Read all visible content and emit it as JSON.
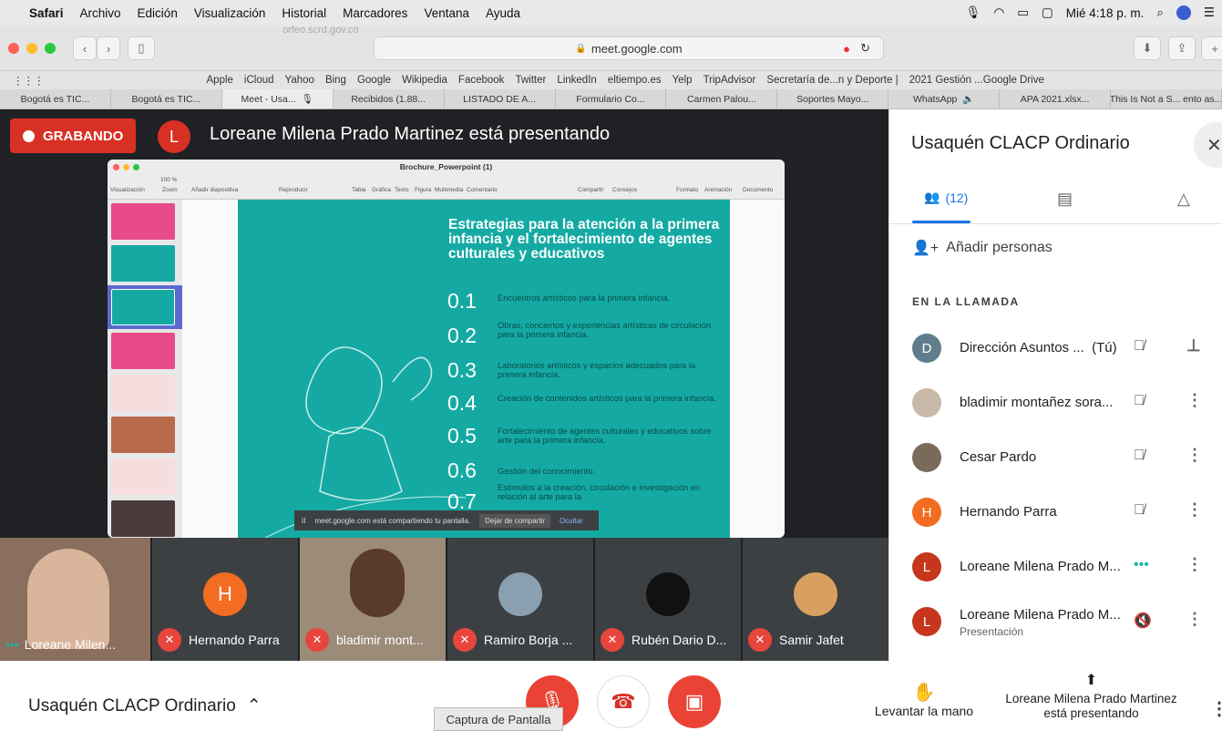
{
  "menubar": {
    "app": "Safari",
    "items": [
      "Archivo",
      "Edición",
      "Visualización",
      "Historial",
      "Marcadores",
      "Ventana",
      "Ayuda"
    ],
    "clock": "Mié 4:18 p. m."
  },
  "browser": {
    "url": "meet.google.com",
    "ghost_title": "orfeo.scrd.gov.co",
    "bookmarks": [
      "Apple",
      "iCloud",
      "Yahoo",
      "Bing",
      "Google",
      "Wikipedia",
      "Facebook",
      "Twitter",
      "LinkedIn",
      "eltiempo.es",
      "Yelp",
      "TripAdvisor",
      "Secretaría de...n y Deporte |",
      "2021 Gestión ...Google Drive"
    ],
    "tabs": [
      "Bogotá es TIC...",
      "Bogotá es TIC...",
      "Meet - Usa...",
      "Recibidos (1.88...",
      "LISTADO DE A...",
      "Formulario Co...",
      "Carmen Palou...",
      "Soportes Mayo...",
      "WhatsApp",
      "APA 2021.xlsx...",
      "This Is Not a S... ento as..."
    ]
  },
  "stage": {
    "recording_label": "GRABANDO",
    "presenter_initial": "L",
    "presenting_text": "Loreane Milena Prado Martinez está presentando"
  },
  "keynote": {
    "title": "Brochure_Powerpoint (1)",
    "toolbar": [
      "Visualización",
      "Zoom",
      "Añadir diapositiva",
      "Reproducir",
      "Tabla",
      "Gráfica",
      "Texto",
      "Figura",
      "Multimedia",
      "Comentario",
      "Compartir",
      "Consejos",
      "Formato",
      "Animación",
      "Documento"
    ],
    "zoom": "100 %",
    "slide_title": "Estrategias para la atención a la primera infancia y el fortalecimiento de agentes culturales y educativos",
    "items": [
      {
        "num": "0.1",
        "text": "Encuentros artísticos para la primera infancia."
      },
      {
        "num": "0.2",
        "text": "Obras, conciertos y experiencias artísticas de circulación para la primera infancia."
      },
      {
        "num": "0.3",
        "text": "Laboratorios artísticos y espacios adecuados para la primera infancia."
      },
      {
        "num": "0.4",
        "text": "Creación de contenidos artísticos para la primera infancia."
      },
      {
        "num": "0.5",
        "text": "Fortalecimiento de agentes culturales y educativos sobre arte para la primera infancia."
      },
      {
        "num": "0.6",
        "text": "Gestión del conocimiento."
      },
      {
        "num": "0.7",
        "text": "Estímulos a la creación, circulación e investigación en relación al arte para la"
      }
    ]
  },
  "share_bar": {
    "text": "meet.google.com está compartiendo tu pantalla.",
    "stop": "Dejar de compartir",
    "hide": "Ocultar"
  },
  "tiles": [
    {
      "name": "Loreane Milen...",
      "initial": "",
      "muted": false
    },
    {
      "name": "Hernando Parra",
      "initial": "H",
      "muted": true
    },
    {
      "name": "bladimir mont...",
      "initial": "",
      "muted": true
    },
    {
      "name": "Ramiro Borja ...",
      "initial": "",
      "muted": true
    },
    {
      "name": "Rubén Dario D...",
      "initial": "",
      "muted": true
    },
    {
      "name": "Samir Jafet",
      "initial": "",
      "muted": true
    }
  ],
  "sidebar": {
    "title": "Usaquén CLACP Ordinario",
    "people_count": "(12)",
    "add_people": "Añadir personas",
    "section": "EN LA LLAMADA",
    "participants": [
      {
        "name": "Dirección Asuntos ...",
        "suffix": "(Tú)",
        "initial": "D",
        "color": "#607d8b",
        "sub": ""
      },
      {
        "name": "bladimir montañez sora...",
        "suffix": "",
        "initial": "",
        "color": "#c8b8a8",
        "sub": ""
      },
      {
        "name": "Cesar Pardo",
        "suffix": "",
        "initial": "",
        "color": "#7a6a5a",
        "sub": ""
      },
      {
        "name": "Hernando Parra",
        "suffix": "",
        "initial": "H",
        "color": "#f26d21",
        "sub": ""
      },
      {
        "name": "Loreane Milena Prado M...",
        "suffix": "",
        "initial": "L",
        "color": "#c5361c",
        "sub": ""
      },
      {
        "name": "Loreane Milena Prado M...",
        "suffix": "",
        "initial": "L",
        "color": "#c5361c",
        "sub": "Presentación"
      }
    ]
  },
  "bottom": {
    "meeting_name": "Usaquén CLACP Ordinario",
    "tooltip": "Captura de Pantalla",
    "raise_hand": "Levantar la mano",
    "presenting": "Loreane Milena Prado Martinez está presentando"
  }
}
